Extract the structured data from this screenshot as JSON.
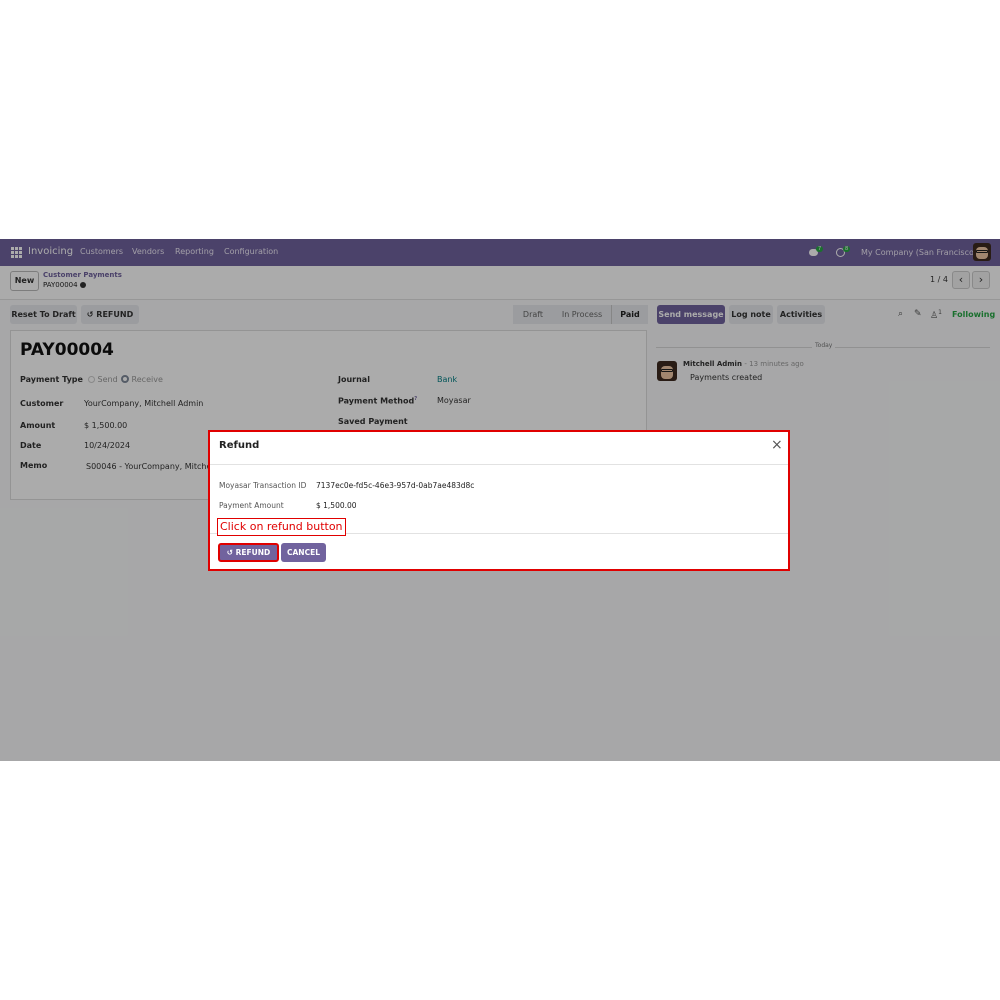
{
  "navbar": {
    "brand": "Invoicing",
    "menus": [
      "Customers",
      "Vendors",
      "Reporting",
      "Configuration"
    ],
    "messages_count": "7",
    "activities_count": "8",
    "company": "My Company (San Francisco)"
  },
  "control_panel": {
    "new_label": "New",
    "breadcrumb_parent": "Customer Payments",
    "breadcrumb_current": "PAY00004",
    "pager": "1 / 4",
    "prev_icon": "chevron-left-icon",
    "next_icon": "chevron-right-icon"
  },
  "statusbar": {
    "reset_label": "Reset To Draft",
    "refund_label": "REFUND",
    "stages": [
      "Draft",
      "In Process",
      "Paid"
    ],
    "active_stage": "Paid"
  },
  "chatter": {
    "send_message": "Send message",
    "log_note": "Log note",
    "activities": "Activities",
    "followers_count": "1",
    "following": "Following",
    "date_separator": "Today",
    "message": {
      "author": "Mitchell Admin",
      "time": "- 13 minutes ago",
      "body": "Payments created"
    }
  },
  "form": {
    "title": "PAY00004",
    "payment_type_label": "Payment Type",
    "payment_type_options": [
      "Send",
      "Receive"
    ],
    "payment_type_selected": "Receive",
    "customer_label": "Customer",
    "customer_value": "YourCompany, Mitchell Admin",
    "amount_label": "Amount",
    "amount_value": "$ 1,500.00",
    "date_label": "Date",
    "date_value": "10/24/2024",
    "memo_label": "Memo",
    "memo_value": "S00046 - YourCompany, Mitchell",
    "journal_label": "Journal",
    "journal_value": "Bank",
    "payment_method_label": "Payment Method",
    "payment_method_help": "?",
    "payment_method_value": "Moyasar",
    "saved_payment_label": "Saved Payment"
  },
  "dialog": {
    "title": "Refund",
    "transaction_label": "Moyasar Transaction ID",
    "transaction_value": "7137ec0e-fd5c-46e3-957d-0ab7ae483d8c",
    "amount_label": "Payment Amount",
    "amount_value": "$ 1,500.00",
    "annotation": "Click on refund button",
    "refund_label": "REFUND",
    "cancel_label": "CANCEL"
  },
  "colors": {
    "brand": "#71639e",
    "link": "#017e84",
    "highlight": "#e00000",
    "following": "#28a745"
  }
}
